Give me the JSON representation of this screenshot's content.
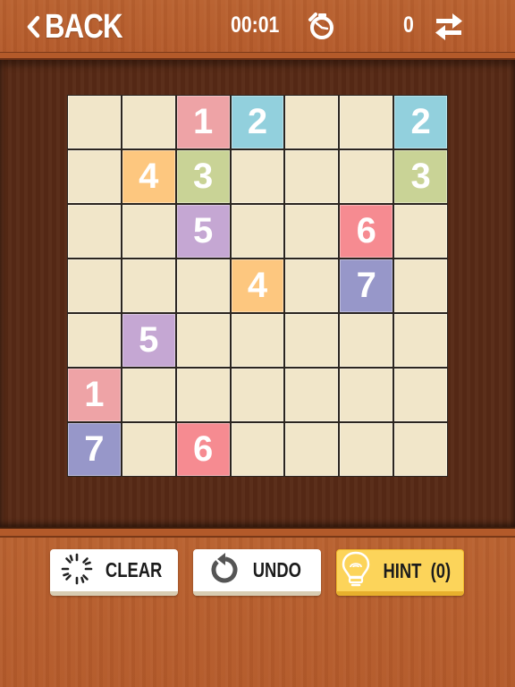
{
  "header": {
    "back_label": "BACK",
    "timer": "00:01",
    "moves": "0",
    "icons": {
      "back": "chevron-left-icon",
      "timer": "stopwatch-icon",
      "swap": "swap-arrows-icon"
    }
  },
  "board": {
    "rows": 7,
    "cols": 7,
    "empty_color": "#f1e6c9",
    "colors": {
      "1": "#eea3a6",
      "2": "#92d0dd",
      "3": "#c9d396",
      "4": "#fdc77f",
      "5": "#c5a7d3",
      "6": "#f68b91",
      "7": "#9797c9"
    },
    "cells": [
      [
        "",
        "",
        "1",
        "2",
        "",
        "",
        "2"
      ],
      [
        "",
        "4",
        "3",
        "",
        "",
        "",
        "3"
      ],
      [
        "",
        "",
        "5",
        "",
        "",
        "6",
        ""
      ],
      [
        "",
        "",
        "",
        "4",
        "",
        "7",
        ""
      ],
      [
        "",
        "5",
        "",
        "",
        "",
        "",
        ""
      ],
      [
        "1",
        "",
        "",
        "",
        "",
        "",
        ""
      ],
      [
        "7",
        "",
        "6",
        "",
        "",
        "",
        ""
      ]
    ]
  },
  "toolbar": {
    "clear_label": "CLEAR",
    "undo_label": "UNDO",
    "hint_label": "HINT",
    "hint_count": "(0)",
    "icons": {
      "clear": "burst-icon",
      "undo": "undo-arrow-icon",
      "hint": "lightbulb-icon"
    },
    "hint_color": "#fcd45a"
  }
}
